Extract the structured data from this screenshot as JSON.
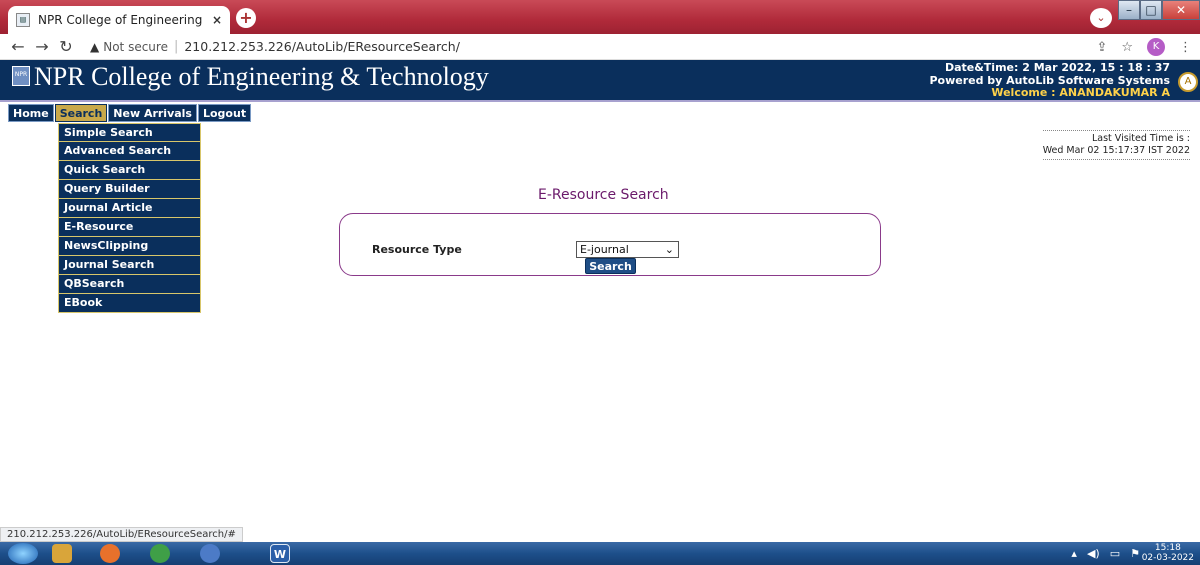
{
  "browser": {
    "tab_title": "NPR College of Engineering & Te",
    "tab_close": "×",
    "new_tab": "+",
    "address": {
      "security_label": "Not secure",
      "url": "210.212.253.226/AutoLib/EResourceSearch/"
    },
    "profile_initial": "K",
    "status_url": "210.212.253.226/AutoLib/EResourceSearch/#"
  },
  "site": {
    "college_name": "NPR College of Engineering & Technology",
    "logo_text": "NPR",
    "datetime": "Date&Time:  2 Mar 2022, 15 : 18 : 37",
    "powered_by": "Powered by AutoLib Software Systems",
    "welcome": "Welcome   :  ANANDAKUMAR A"
  },
  "nav": {
    "items": [
      {
        "label": "Home"
      },
      {
        "label": "Search"
      },
      {
        "label": "New Arrivals"
      },
      {
        "label": "Logout"
      }
    ],
    "search_menu": [
      {
        "label": "Simple Search"
      },
      {
        "label": "Advanced Search"
      },
      {
        "label": "Quick Search"
      },
      {
        "label": "Query Builder"
      },
      {
        "label": "Journal Article"
      },
      {
        "label": "E-Resource"
      },
      {
        "label": "NewsClipping"
      },
      {
        "label": "Journal Search"
      },
      {
        "label": "QBSearch"
      },
      {
        "label": "EBook"
      }
    ]
  },
  "last_visited": {
    "label": "Last Visited Time is :",
    "value": "Wed Mar 02 15:17:37 IST 2022"
  },
  "main": {
    "title": "E-Resource Search",
    "resource_type_label": "Resource Type",
    "resource_type_value": "E-journal",
    "search_button": "Search"
  },
  "taskbar": {
    "word_label": "W",
    "time": "15:18",
    "date": "02-03-2022"
  }
}
